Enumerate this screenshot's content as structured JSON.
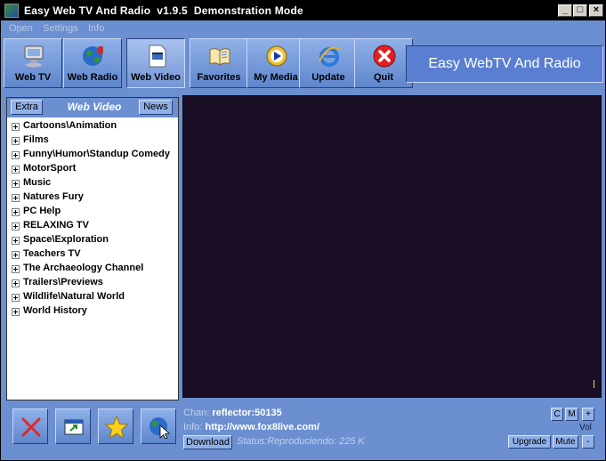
{
  "window": {
    "title": "Easy Web TV And Radio  v1.9.5  Demonstration Mode",
    "controls": {
      "minimize": "_",
      "maximize": "□",
      "close": "×"
    }
  },
  "menu": [
    "Open",
    "Settings",
    "Info"
  ],
  "toolbar": {
    "buttons": [
      {
        "label": "Web TV",
        "icon": "web-tv-icon"
      },
      {
        "label": "Web Radio",
        "icon": "globe-radio-icon"
      },
      {
        "label": "Web Video",
        "icon": "video-file-icon",
        "active": true
      },
      {
        "label": "Favorites",
        "icon": "book-icon"
      },
      {
        "label": "My Media",
        "icon": "media-player-icon"
      },
      {
        "label": "Update",
        "icon": "ie-update-icon"
      },
      {
        "label": "Quit",
        "icon": "quit-icon"
      }
    ],
    "brand": "Easy WebTV And Radio"
  },
  "panel": {
    "left_button": "Extra",
    "title": "Web Video",
    "right_button": "News",
    "items": [
      "Cartoons\\Animation",
      "Films",
      "Funny\\Humor\\Standup Comedy",
      "MotorSport",
      "Music",
      "Natures Fury",
      "PC Help",
      "RELAXING TV",
      "Space\\Exploration",
      "Teachers TV",
      "The Archaeology Channel",
      "Trailers\\Previews",
      "Wildlife\\Natural World",
      "World History"
    ]
  },
  "bottom_buttons": [
    "delete-icon",
    "popout-window-icon",
    "star-icon",
    "web-globe-icon"
  ],
  "info": {
    "chan_label": "Chan:",
    "chan_value": "reflector:50135",
    "info_label": "Info:",
    "info_value": "http://www.fox8live.com/",
    "download": "Download",
    "status": "Status:Reproduciendo: 225 K"
  },
  "side_controls": {
    "c": "C",
    "m": "M",
    "plus": "+",
    "minus": "-",
    "vol": "Vol",
    "upgrade": "Upgrade",
    "mute": "Mute"
  },
  "colors": {
    "background": "#6b8fd0",
    "video": "#1a0f24",
    "brand_text": "#ffffff"
  }
}
